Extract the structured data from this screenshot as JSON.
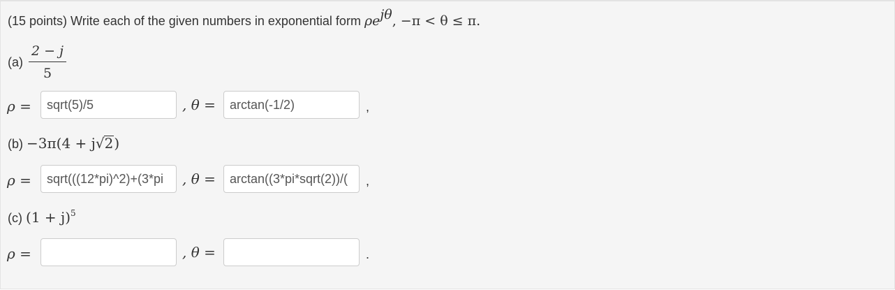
{
  "question": {
    "title_text": "(15 points) Write each of the given numbers in exponential form ",
    "title_math_rho": "ρ",
    "title_math_e": "e",
    "title_math_exp": "jθ",
    "title_math_range": ", −π < θ ≤ π.",
    "parts": {
      "a": {
        "label": "(a)",
        "numerator": "2 − j",
        "denominator": "5",
        "rho_value": "sqrt(5)/5",
        "theta_value": "arctan(-1/2)",
        "end_punct": ","
      },
      "b": {
        "label": "(b)",
        "expr_pre": "−3π(4 + j",
        "sqrt_sign": "√",
        "sqrt_arg": "2",
        "expr_post": ")",
        "rho_value": "sqrt(((12*pi)^2)+(3*pi",
        "theta_value": "arctan((3*pi*sqrt(2))/(",
        "end_punct": ","
      },
      "c": {
        "label": "(c)",
        "expr": "(1 + j)",
        "exp": "5",
        "rho_value": "",
        "theta_value": "",
        "end_punct": "."
      }
    },
    "rho_label": "ρ =",
    "theta_label": ", θ ="
  }
}
